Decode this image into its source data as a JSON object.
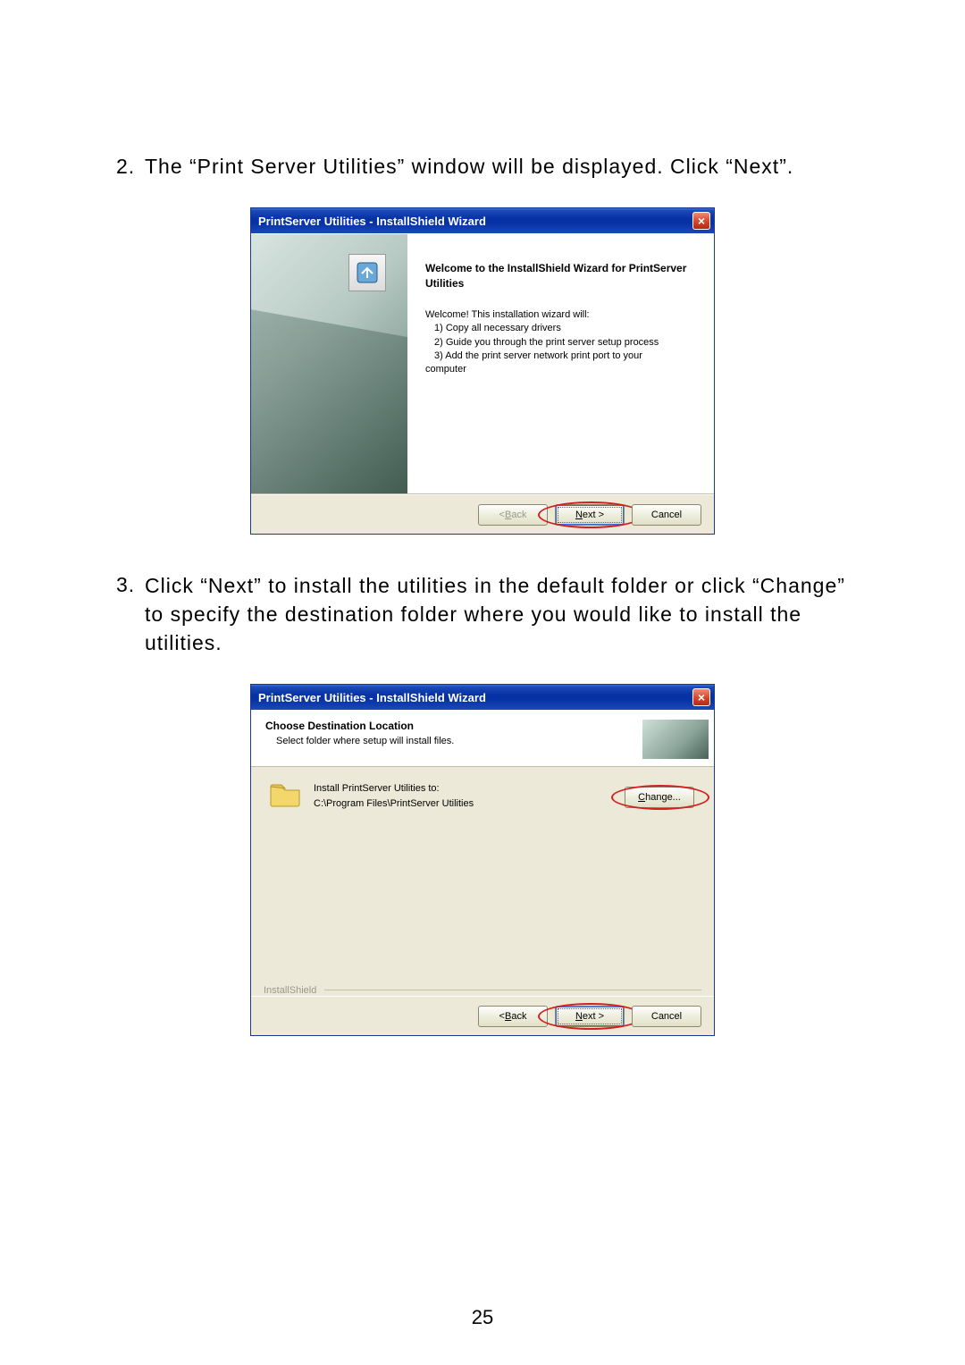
{
  "step2": {
    "num": "2.",
    "text": "The “Print Server Utilities” window will be displayed. Click “Next”."
  },
  "step3": {
    "num": "3.",
    "text": "Click “Next” to install the utilities in the default folder or click “Change” to specify the destination folder where you would like to install the utilities."
  },
  "dialog1": {
    "title": "PrintServer Utilities - InstallShield Wizard",
    "welcome_heading": "Welcome to the InstallShield Wizard for PrintServer Utilities",
    "body_intro": "Welcome! This installation wizard will:",
    "body1": "1) Copy all necessary drivers",
    "body2": "2) Guide you through the print server setup process",
    "body3": "3) Add the print server network print port to your",
    "body_last": "computer",
    "back_prefix": "< ",
    "back_u": "B",
    "back_suffix": "ack",
    "next_u": "N",
    "next_suffix": "ext >",
    "cancel": "Cancel"
  },
  "dialog2": {
    "title": "PrintServer Utilities - InstallShield Wizard",
    "heading": "Choose Destination Location",
    "sub": "Select folder where setup will install files.",
    "install_to": "Install PrintServer Utilities to:",
    "path": "C:\\Program Files\\PrintServer Utilities",
    "change_u": "C",
    "change_suffix": "hange...",
    "brand": "InstallShield",
    "back_prefix": "< ",
    "back_u": "B",
    "back_suffix": "ack",
    "next_u": "N",
    "next_suffix": "ext >",
    "cancel": "Cancel"
  },
  "page_number": "25"
}
